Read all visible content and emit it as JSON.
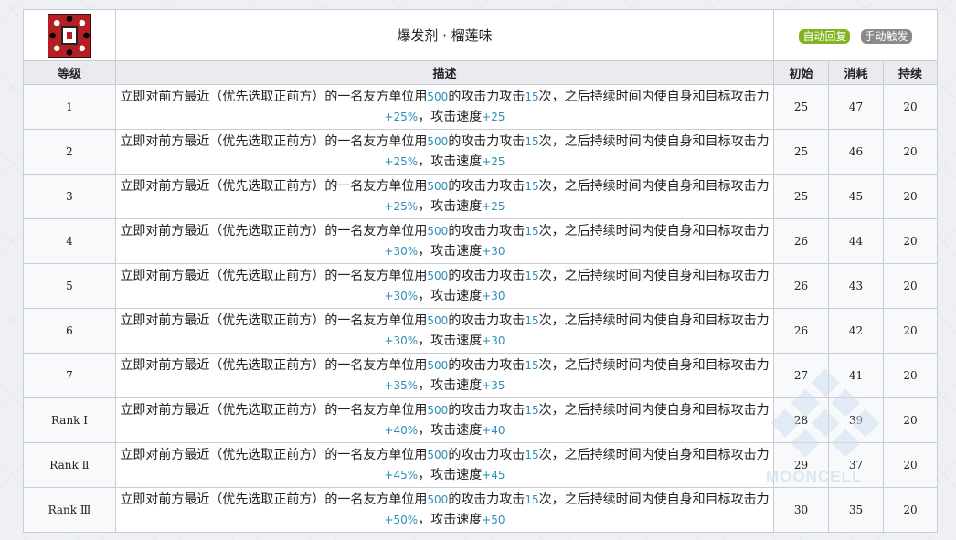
{
  "skill": {
    "name": "爆发剂 · 榴莲味",
    "icon": "skill-icon",
    "tags": [
      {
        "label": "自动回复",
        "color": "#7fb51f"
      },
      {
        "label": "手动触发",
        "color": "#8a8a8a"
      }
    ]
  },
  "columns": {
    "level": "等级",
    "desc": "描述",
    "initial": "初始",
    "cost": "消耗",
    "duration": "持续"
  },
  "desc_text": {
    "p1": "立即对前方最近（优先选取正前方）的一名友方单位用",
    "p2": "的攻击力攻击",
    "p3": "次，之后持续时间内使自身和目标攻击力",
    "p4": "，攻击速度"
  },
  "rows": [
    {
      "level": "1",
      "atk_pct": "500",
      "hits": "15",
      "atk_up": "+25%",
      "aspd": "+25",
      "initial": "25",
      "cost": "47",
      "duration": "20"
    },
    {
      "level": "2",
      "atk_pct": "500",
      "hits": "15",
      "atk_up": "+25%",
      "aspd": "+25",
      "initial": "25",
      "cost": "46",
      "duration": "20"
    },
    {
      "level": "3",
      "atk_pct": "500",
      "hits": "15",
      "atk_up": "+25%",
      "aspd": "+25",
      "initial": "25",
      "cost": "45",
      "duration": "20"
    },
    {
      "level": "4",
      "atk_pct": "500",
      "hits": "15",
      "atk_up": "+30%",
      "aspd": "+30",
      "initial": "26",
      "cost": "44",
      "duration": "20"
    },
    {
      "level": "5",
      "atk_pct": "500",
      "hits": "15",
      "atk_up": "+30%",
      "aspd": "+30",
      "initial": "26",
      "cost": "43",
      "duration": "20"
    },
    {
      "level": "6",
      "atk_pct": "500",
      "hits": "15",
      "atk_up": "+30%",
      "aspd": "+30",
      "initial": "26",
      "cost": "42",
      "duration": "20"
    },
    {
      "level": "7",
      "atk_pct": "500",
      "hits": "15",
      "atk_up": "+35%",
      "aspd": "+35",
      "initial": "27",
      "cost": "41",
      "duration": "20"
    },
    {
      "level": "Rank Ⅰ",
      "atk_pct": "500",
      "hits": "15",
      "atk_up": "+40%",
      "aspd": "+40",
      "initial": "28",
      "cost": "39",
      "duration": "20"
    },
    {
      "level": "Rank Ⅱ",
      "atk_pct": "500",
      "hits": "15",
      "atk_up": "+45%",
      "aspd": "+45",
      "initial": "29",
      "cost": "37",
      "duration": "20"
    },
    {
      "level": "Rank Ⅲ",
      "atk_pct": "500",
      "hits": "15",
      "atk_up": "+50%",
      "aspd": "+50",
      "initial": "30",
      "cost": "35",
      "duration": "20"
    }
  ],
  "watermark": {
    "text": "MOONCELL",
    "icon": "mooncell-logo-icon"
  }
}
